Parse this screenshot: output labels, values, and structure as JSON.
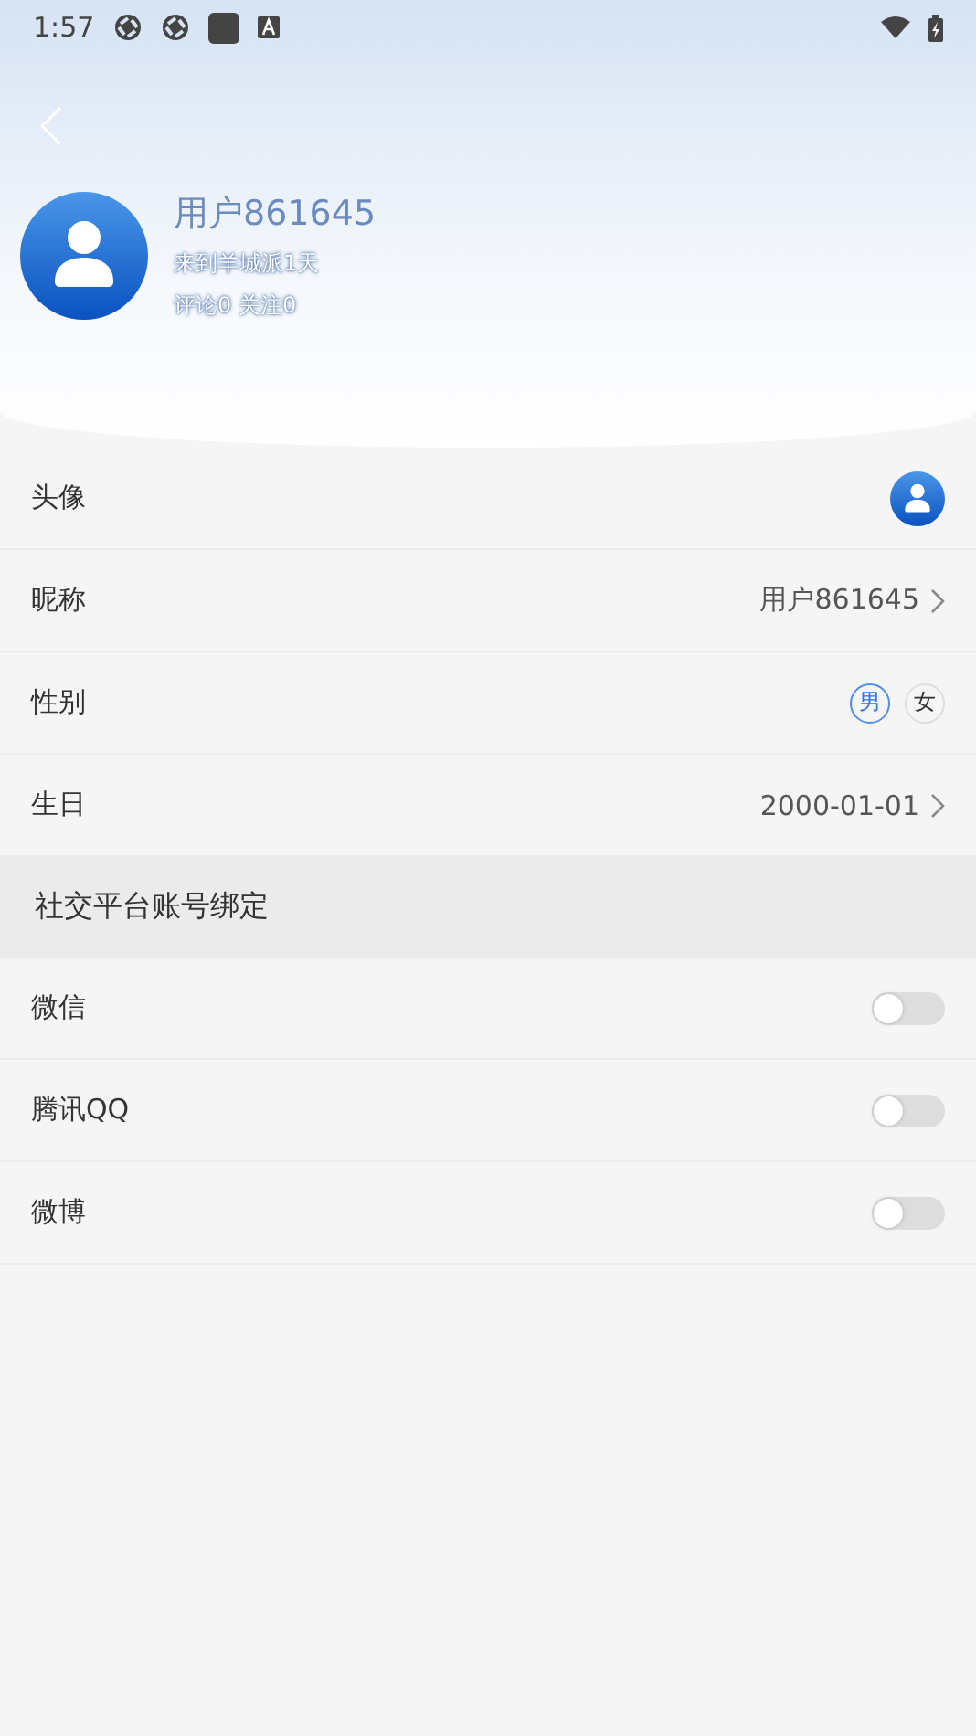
{
  "status_bar": {
    "time": "1:57"
  },
  "profile": {
    "name": "用户861645",
    "days": "来到羊城派1天",
    "stats": "评论0  关注0"
  },
  "rows": [
    {
      "kind": "avatar",
      "label": "头像"
    },
    {
      "kind": "value",
      "label": "昵称",
      "value": "用户861645"
    },
    {
      "kind": "gender",
      "label": "性别",
      "options": [
        {
          "label": "男",
          "selected": true
        },
        {
          "label": "女",
          "selected": false
        }
      ]
    },
    {
      "kind": "value",
      "label": "生日",
      "value": "2000-01-01"
    }
  ],
  "section": {
    "title": "社交平台账号绑定"
  },
  "bindings": [
    {
      "label": "微信",
      "on": false
    },
    {
      "label": "腾讯QQ",
      "on": false
    },
    {
      "label": "微博",
      "on": false
    }
  ]
}
